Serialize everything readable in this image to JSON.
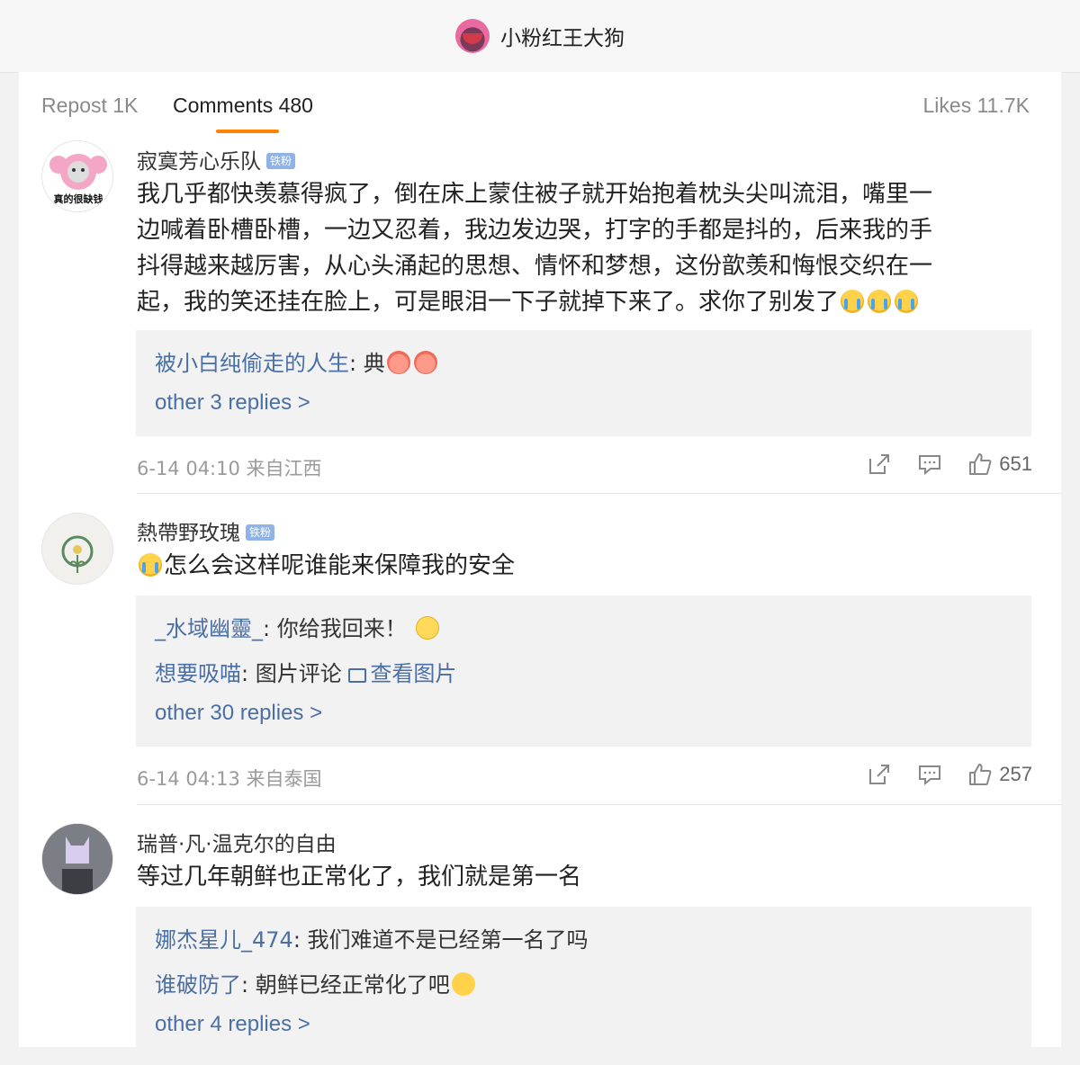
{
  "header": {
    "title": "小粉红王大狗"
  },
  "tabs": {
    "repost": "Repost 1K",
    "comments": "Comments 480",
    "likes": "Likes 11.7K"
  },
  "comments": [
    {
      "username": "寂寞芳心乐队",
      "badge": "铁粉",
      "avatar_text": "真的很缺钱",
      "lines": [
        "我几乎都快羡慕得疯了，倒在床上蒙住被子就开始抱着枕头尖叫流泪，嘴里一",
        "边喊着卧槽卧槽，一边又忍着，我边发边哭，打字的手都是抖的，后来我的手",
        "抖得越来越厉害，从心头涌起的思想、情怀和梦想，这份歆羡和悔恨交织在一",
        "起，我的笑还挂在脸上，可是眼泪一下子就掉下来了。求你了别发了"
      ],
      "replies": [
        {
          "name": "被小白纯偷走的人生",
          "text": ": 典"
        }
      ],
      "more": "other 3 replies >",
      "meta": "6-14 04:10 来自江西",
      "likes": "651"
    },
    {
      "username": "熱帶野玫瑰",
      "badge": "铁粉",
      "lines": [
        "怎么会这样呢谁能来保障我的安全"
      ],
      "replies": [
        {
          "name": "_水域幽靈_",
          "text": ": 你给我回来！"
        },
        {
          "name": "想要吸喵",
          "text": ": 图片评论 ",
          "link": "查看图片"
        }
      ],
      "more": "other 30 replies >",
      "meta": "6-14 04:13 来自泰国",
      "likes": "257"
    },
    {
      "username": "瑞普·凡·温克尔的自由",
      "lines": [
        "等过几年朝鲜也正常化了，我们就是第一名"
      ],
      "replies": [
        {
          "name": "娜杰星儿_474",
          "text": ": 我们难道不是已经第一名了吗"
        },
        {
          "name": "谁破防了",
          "text": ": 朝鲜已经正常化了吧"
        }
      ],
      "more": "other 4 replies >"
    }
  ],
  "icons": [
    "share-icon",
    "comment-icon",
    "like-icon"
  ],
  "colors": {
    "accent": "#ff8200",
    "link": "#4a6fa5",
    "badge": "#8fb3e6"
  }
}
